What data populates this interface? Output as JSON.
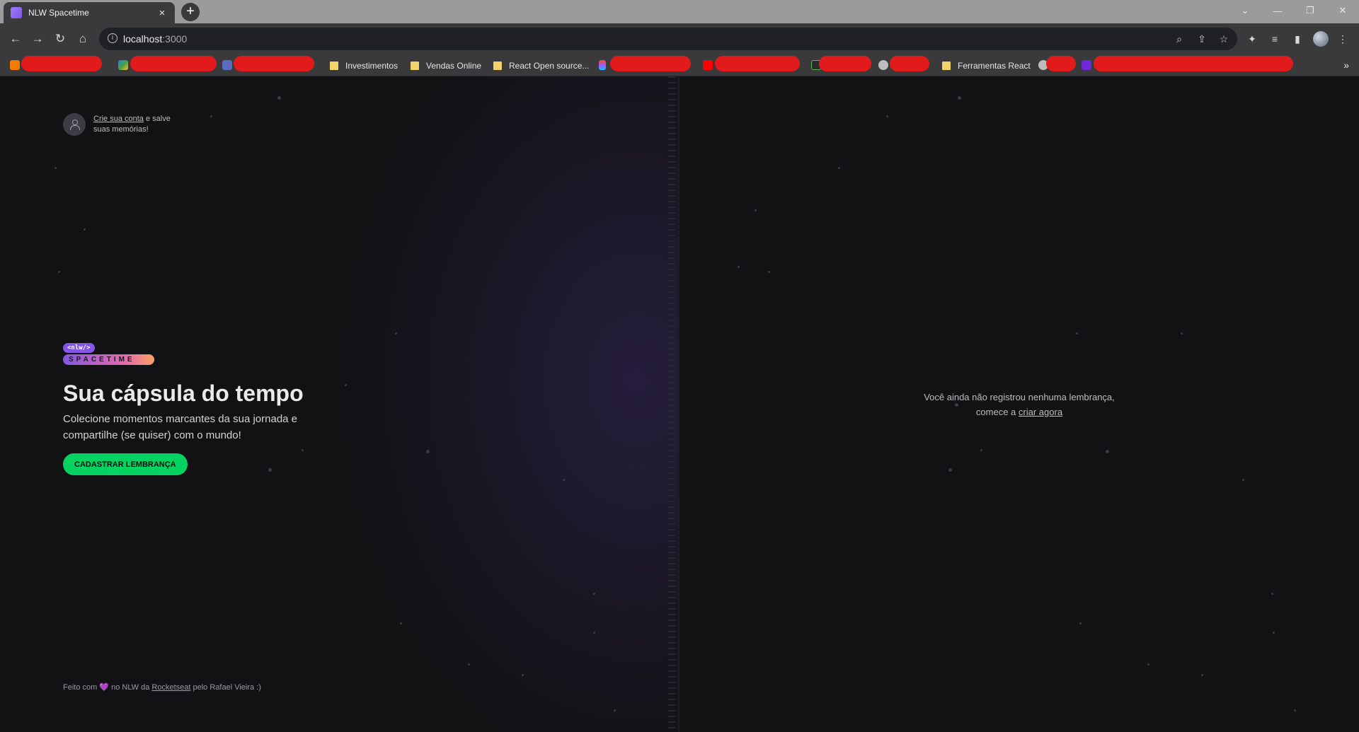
{
  "tab": {
    "title": "NLW Spacetime",
    "close": "×",
    "new_tab": "+"
  },
  "window": {
    "minimize": "—",
    "restore": "❐",
    "close": "✕",
    "chevron": "⌄"
  },
  "toolbar": {
    "back": "←",
    "forward": "→",
    "reload": "↻",
    "home": "⌂",
    "url_host": "localhost",
    "url_port": ":3000"
  },
  "bookmarks": [
    {
      "label": "Investimentos"
    },
    {
      "label": "Vendas Online"
    },
    {
      "label": "React Open source..."
    },
    {
      "label": "Ferramentas React"
    }
  ],
  "bookmarks_more": "»",
  "signin": {
    "link": "Crie sua conta",
    "rest": " e salve suas memórias!"
  },
  "logo": {
    "top": "<nlw/>",
    "bottom": "SPACETIME"
  },
  "hero": {
    "title": "Sua cápsula do tempo",
    "subtitle": "Colecione momentos marcantes da sua jornada e compartilhe (se quiser) com o mundo!",
    "cta": "CADASTRAR LEMBRANÇA"
  },
  "footer": {
    "prefix": "Feito com",
    "heart": "💜",
    "middle": "no NLW da",
    "link": "Rocketseat",
    "suffix": "pelo Rafael Vieira :)"
  },
  "empty": {
    "line1": "Você ainda não registrou nenhuma lembrança,",
    "line2_prefix": "comece a",
    "line2_link": "criar agora"
  },
  "colors": {
    "accent": "#8257e5",
    "cta": "#04d361",
    "background": "#121215"
  }
}
